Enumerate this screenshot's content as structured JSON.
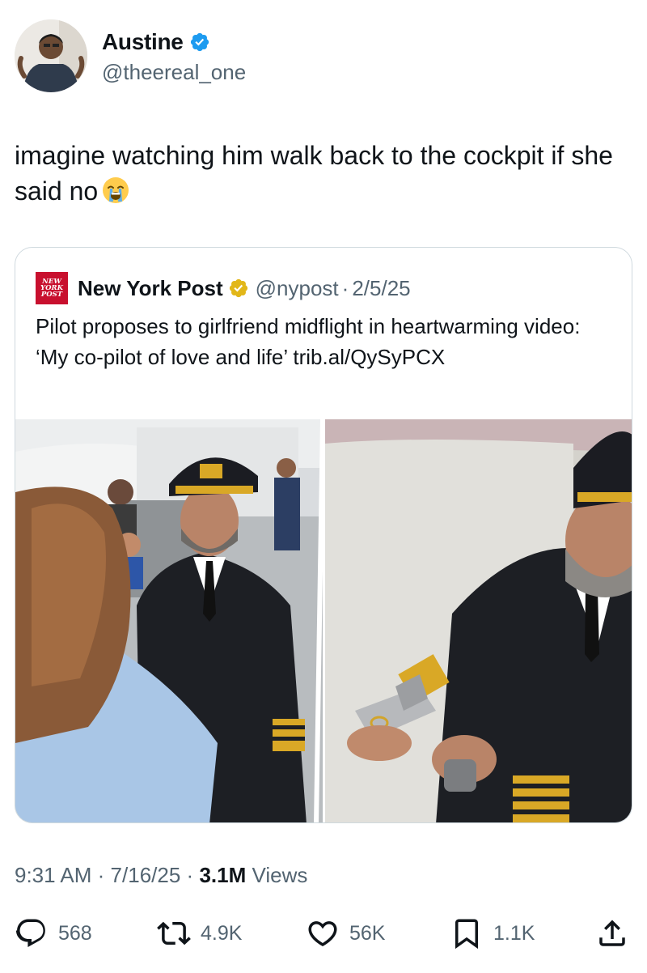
{
  "author": {
    "display_name": "Austine",
    "handle": "@theereal_one",
    "verified_color": "#1d9bf0"
  },
  "tweet": {
    "text": "imagine watching him walk back to the cockpit if she said no",
    "emoji": "loudly-crying-face"
  },
  "quoted": {
    "logo_text": [
      "NEW",
      "YORK",
      "POST"
    ],
    "display_name": "New York Post",
    "badge": "gold-verified-badge",
    "handle": "@nypost",
    "separator": "·",
    "date": "2/5/25",
    "text": "Pilot proposes to girlfriend midflight in heartwarming video: ‘My co-pilot of love and life’ trib.al/QySyPCX",
    "media_alt": "Pilot in uniform proposing to a woman in the aisle of an airplane; close-up of pilot holding an open ring box"
  },
  "meta": {
    "time": "9:31 AM",
    "sep1": "·",
    "date": "7/16/25",
    "sep2": "·",
    "views_count": "3.1M",
    "views_label": "Views"
  },
  "actions": {
    "replies": "568",
    "reposts": "4.9K",
    "likes": "56K",
    "bookmarks": "1.1K"
  },
  "colors": {
    "text": "#0f1419",
    "secondary": "#536471",
    "border": "#cfd9de",
    "nyp_red": "#c8102e",
    "gold": "#e2b719"
  }
}
